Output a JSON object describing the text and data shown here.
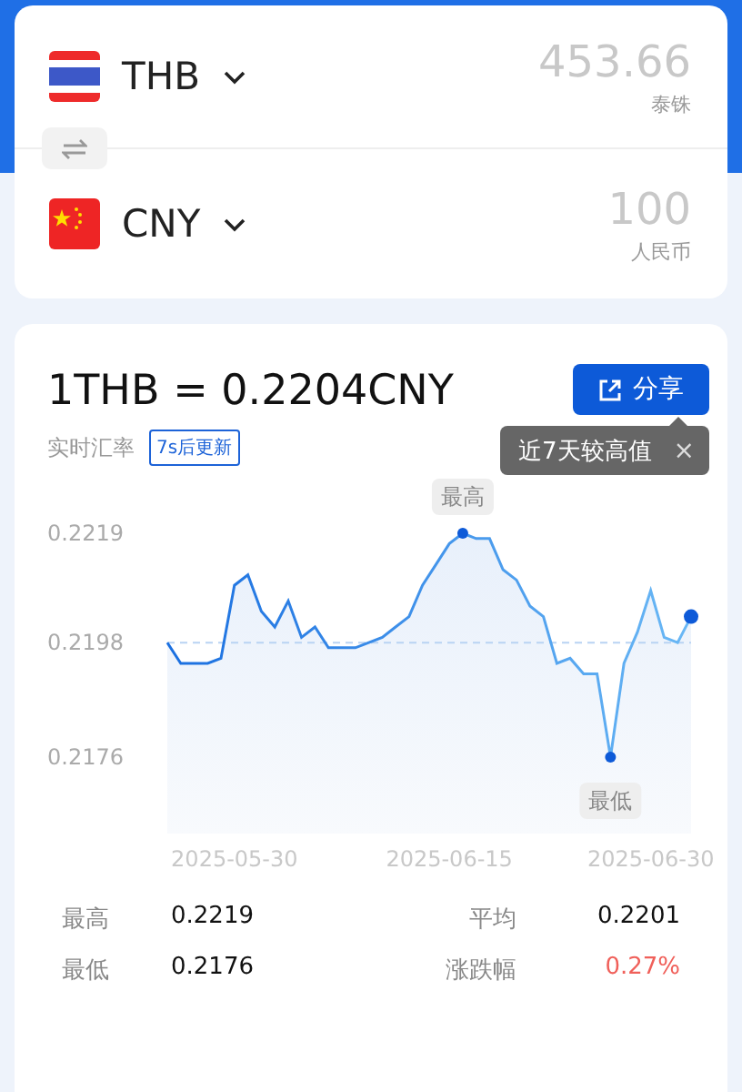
{
  "converter": {
    "rows": [
      {
        "code": "THB",
        "kind": "thailand",
        "amount": "453.66",
        "name": "泰铢"
      },
      {
        "code": "CNY",
        "kind": "china",
        "amount": "100",
        "name": "人民币"
      }
    ]
  },
  "rate": {
    "title": "1THB = 0.2204CNY",
    "label": "实时汇率",
    "countdown": "7s后更新",
    "share": "分享",
    "tooltip": "近7天较高值",
    "tooltip_close": "×",
    "chart_data": {
      "type": "area",
      "categories": [
        null,
        null,
        null,
        null,
        null,
        "2025-05-30",
        null,
        null,
        null,
        null,
        null,
        null,
        null,
        null,
        null,
        null,
        null,
        null,
        null,
        null,
        null,
        "2025-06-15",
        null,
        null,
        null,
        null,
        null,
        null,
        null,
        null,
        null,
        null,
        null,
        null,
        null,
        null,
        "2025-06-30",
        null,
        null,
        null
      ],
      "series": [
        {
          "color": "#1a6fe0",
          "values": [
            0.2198,
            0.2194,
            0.2194,
            0.2194,
            0.2195,
            0.2209,
            0.2211,
            0.2204,
            0.2201,
            0.2206,
            0.2199,
            0.2201,
            0.2197,
            0.2197,
            0.2197,
            0.2198,
            0.2199,
            0.2201,
            0.2203,
            0.2209,
            0.2213,
            0.2217,
            0.2219,
            0.2218,
            0.2218,
            0.2212,
            0.221,
            0.2205,
            0.2203,
            0.2194,
            0.2195,
            0.2192,
            0.2192,
            0.2176,
            0.2194,
            0.22,
            0.2208,
            0.2199,
            0.2198,
            0.2203
          ]
        }
      ],
      "ylim": [
        0.2176,
        0.2219
      ],
      "yticks": [
        0.2176,
        0.2198,
        0.2219
      ],
      "annotations": [
        {
          "y": 0.2219,
          "text": "最高"
        },
        {
          "y": 0.2176,
          "text": "最低"
        }
      ]
    },
    "stats": [
      {
        "label": "最高",
        "value": "0.2219",
        "color": "#111111"
      },
      {
        "label": "平均",
        "value": "0.2201",
        "color": "#111111"
      },
      {
        "label": "最低",
        "value": "0.2176",
        "color": "#111111"
      },
      {
        "label": "涨跌幅",
        "value": "0.27%",
        "color": "#f0605a"
      }
    ]
  }
}
